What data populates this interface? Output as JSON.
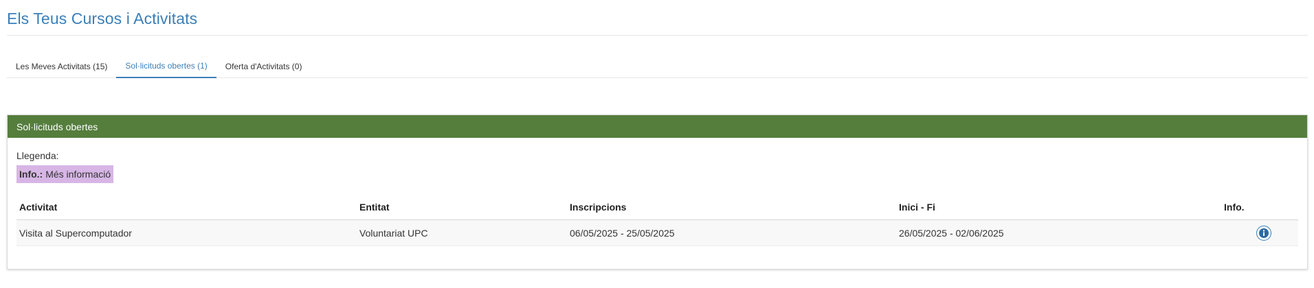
{
  "page": {
    "title": "Els Teus Cursos i Activitats"
  },
  "tabs": [
    {
      "label": "Les Meves Activitats (15)",
      "active": false
    },
    {
      "label": "Sol·licituds obertes (1)",
      "active": true
    },
    {
      "label": "Oferta d'Activitats (0)",
      "active": false
    }
  ],
  "panel": {
    "header": "Sol·licituds obertes",
    "legend_label": "Llegenda:",
    "legend_key": "Info.:",
    "legend_value": "Més informació",
    "legend_color": "#d7b6e6",
    "header_color": "#557e3d"
  },
  "table": {
    "columns": [
      "Activitat",
      "Entitat",
      "Inscripcions",
      "Inici - Fi",
      "Info."
    ],
    "rows": [
      {
        "activitat": "Visita al Supercomputador",
        "entitat": "Voluntariat UPC",
        "inscripcions": "06/05/2025 - 25/05/2025",
        "inici_fi": "26/05/2025 - 02/06/2025",
        "info_icon": "info-circle-icon"
      }
    ]
  },
  "colors": {
    "accent": "#3a7fb8",
    "text": "#333333"
  }
}
